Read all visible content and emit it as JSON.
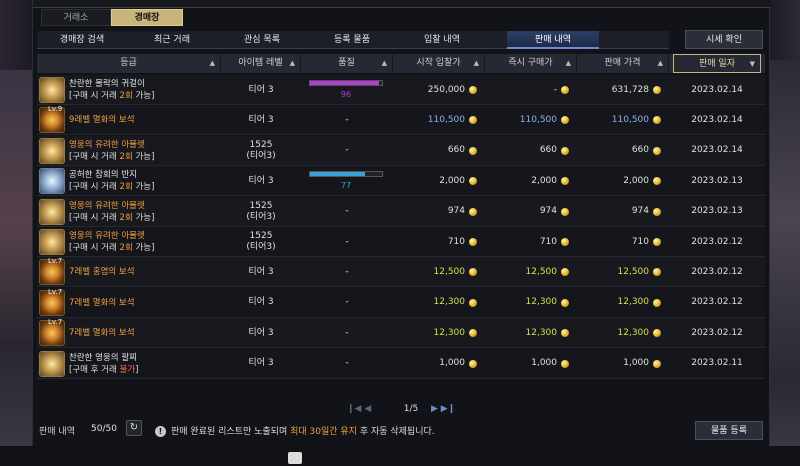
{
  "top_tabs": [
    "거래소",
    "경매장"
  ],
  "sub_tabs": [
    "경매장 검색",
    "최근 거래",
    "관심 목록",
    "등록 물품",
    "입찰 내역",
    "판매 내역"
  ],
  "active_sub_tab": "판매 내역",
  "price_check_label": "시세 확인",
  "columns": [
    "등급",
    "아이템 레벨",
    "품질",
    "시작 입찰가",
    "즉시 구매가",
    "판매 가격",
    "판매 일자"
  ],
  "rows": [
    {
      "icon": "necklace-icon",
      "name": "찬란한 몰락의 귀걸이",
      "name_color": "white",
      "sub": "[구매 시 거래 ",
      "sub_hl": "2회",
      "sub_tail": " 가능]",
      "level": "티어 3",
      "quality": 96,
      "quality_color": "#b23cd6",
      "start_bid": "250,000",
      "buyout": "-",
      "sale_price": "631,728",
      "date": "2023.02.14"
    },
    {
      "icon": "gem-icon",
      "lv": "Lv.9",
      "name": "9레벨 멸화의 보석",
      "name_color": "orange",
      "level": "티어 3",
      "quality": "-",
      "start_bid": "110,500",
      "buyout": "110,500",
      "sale_price": "110,500",
      "date": "2023.02.14",
      "blue": true
    },
    {
      "icon": "relic-icon",
      "name": "영웅의 유려한 아뮬렛",
      "name_color": "orange",
      "sub": "[구매 시 거래 ",
      "sub_hl": "2회",
      "sub_tail": " 가능]",
      "level": "1525",
      "level2": "(티어3)",
      "quality": "-",
      "start_bid": "660",
      "buyout": "660",
      "sale_price": "660",
      "date": "2023.02.14"
    },
    {
      "icon": "ring-icon",
      "name": "공허한 참회의 반지",
      "name_color": "white",
      "sub": "[구매 시 거래 ",
      "sub_hl": "2회",
      "sub_tail": " 가능]",
      "level": "티어 3",
      "quality": 77,
      "quality_color": "#3aa0d8",
      "start_bid": "2,000",
      "buyout": "2,000",
      "sale_price": "2,000",
      "date": "2023.02.13"
    },
    {
      "icon": "relic-icon",
      "name": "영웅의 유려한 아뮬렛",
      "name_color": "orange",
      "sub": "[구매 시 거래 ",
      "sub_hl": "2회",
      "sub_tail": " 가능]",
      "level": "1525",
      "level2": "(티어3)",
      "quality": "-",
      "start_bid": "974",
      "buyout": "974",
      "sale_price": "974",
      "date": "2023.02.13"
    },
    {
      "icon": "relic-icon",
      "name": "영웅의 유려한 아뮬렛",
      "name_color": "orange",
      "sub": "[구매 시 거래 ",
      "sub_hl": "2회",
      "sub_tail": " 가능]",
      "level": "1525",
      "level2": "(티어3)",
      "quality": "-",
      "start_bid": "710",
      "buyout": "710",
      "sale_price": "710",
      "date": "2023.02.12"
    },
    {
      "icon": "gem-icon",
      "lv": "Lv.7",
      "name": "7레벨 홍염의 보석",
      "name_color": "orange",
      "level": "티어 3",
      "quality": "-",
      "start_bid": "12,500",
      "buyout": "12,500",
      "sale_price": "12,500",
      "date": "2023.02.12",
      "yellow": true
    },
    {
      "icon": "gem-icon",
      "lv": "Lv.7",
      "name": "7레벨 멸화의 보석",
      "name_color": "orange",
      "level": "티어 3",
      "quality": "-",
      "start_bid": "12,300",
      "buyout": "12,300",
      "sale_price": "12,300",
      "date": "2023.02.12",
      "yellow": true
    },
    {
      "icon": "gem-icon",
      "lv": "Lv.7",
      "name": "7레벨 멸화의 보석",
      "name_color": "orange",
      "level": "티어 3",
      "quality": "-",
      "start_bid": "12,300",
      "buyout": "12,300",
      "sale_price": "12,300",
      "date": "2023.02.12",
      "yellow": true
    },
    {
      "icon": "relic-icon",
      "name": "찬란한 영웅의 팔찌",
      "name_color": "white",
      "sub": "[구매 후 거래 ",
      "sub_hl": "불가",
      "sub_tail": "]",
      "sub_red": true,
      "level": "티어 3",
      "quality": "-",
      "start_bid": "1,000",
      "buyout": "1,000",
      "sale_price": "1,000",
      "date": "2023.02.11"
    }
  ],
  "pager": {
    "first": "◀◀ ◀",
    "page": "1/5",
    "last": "▶ ▶▶"
  },
  "footer": {
    "label": "판매 내역",
    "count": "50/50",
    "notice_pre": "판매 완료된 리스트만 노출되며 ",
    "notice_hl": "최대 30일간 유지",
    "notice_post": " 후 자동 삭제됩니다.",
    "register": "물품 등록"
  },
  "colors": {
    "accent_gold": "#c8b57a",
    "orange": "#f0a040",
    "blue_price": "#8fb0f0",
    "yellow_price": "#d8e04a"
  }
}
